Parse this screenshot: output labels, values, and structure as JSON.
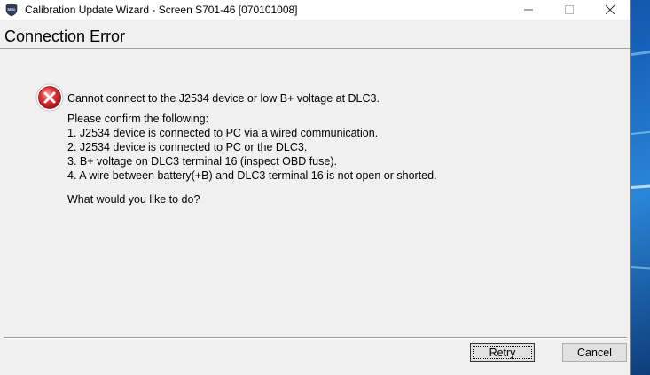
{
  "window": {
    "title": "Calibration Update Wizard - Screen S701-46 [070101008]",
    "icon": "ctweb-shield-icon"
  },
  "title_bar_buttons": {
    "minimize_icon": "minimize-icon",
    "maximize_icon": "maximize-icon",
    "close_icon": "close-icon"
  },
  "header": {
    "title": "Connection Error"
  },
  "message": {
    "icon": "error-icon",
    "headline": "Cannot connect to the J2534 device or low B+ voltage at DLC3.",
    "intro": "Please confirm the following:",
    "items": [
      "1. J2534 device is connected to PC via a wired communication.",
      "2. J2534 device is connected to PC or the DLC3.",
      "3. B+ voltage on DLC3 terminal 16 (inspect OBD fuse).",
      "4. A wire between battery(+B) and DLC3 terminal 16 is not open or shorted."
    ],
    "question": "What would you like to do?"
  },
  "buttons": {
    "retry": "Retry",
    "cancel": "Cancel"
  },
  "colors": {
    "window_bg": "#f0f0f0",
    "error_red": "#d9262a",
    "desktop_blue": "#1660b8"
  }
}
